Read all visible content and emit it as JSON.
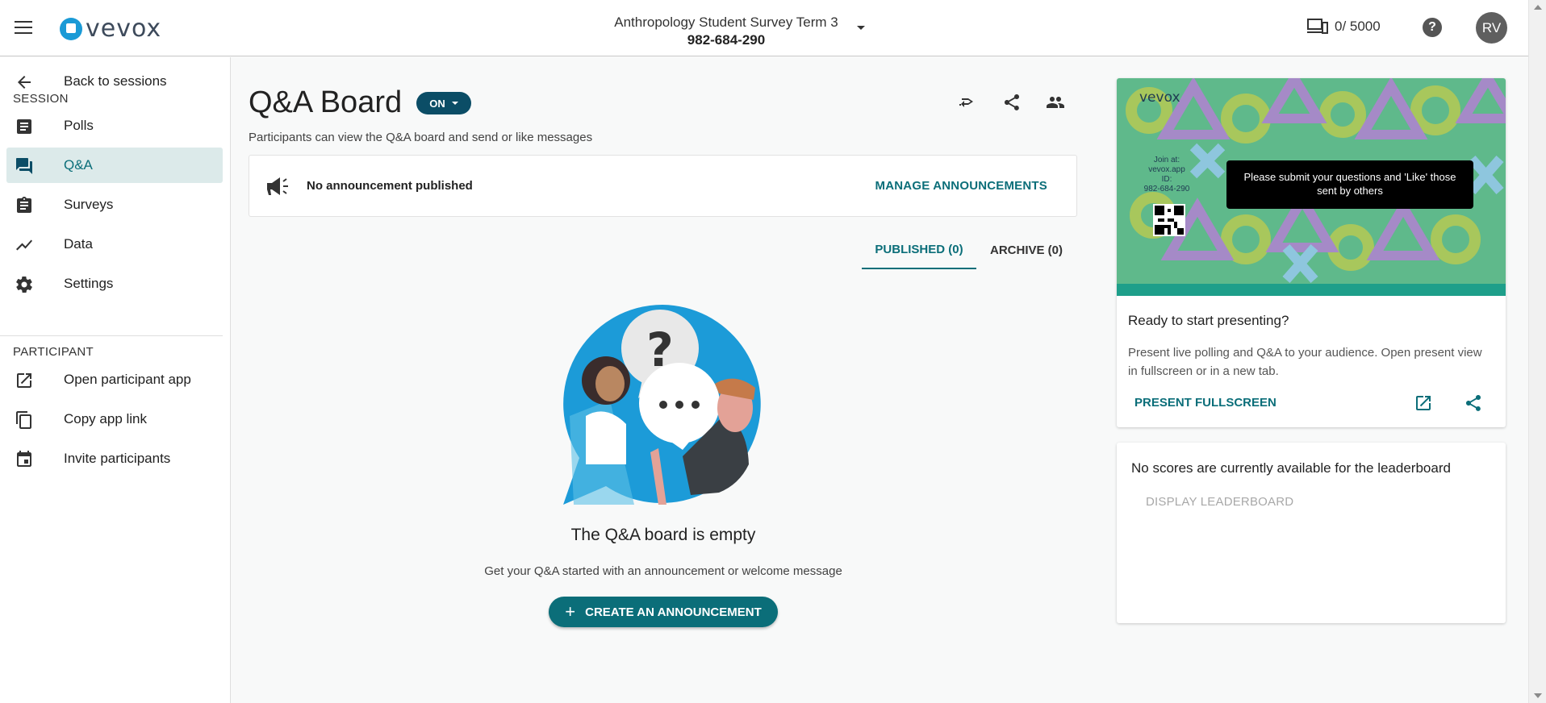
{
  "app": {
    "logo_text": "vevox"
  },
  "header": {
    "session_name": "Anthropology Student Survey Term 3",
    "session_code": "982-684-290",
    "participants_count": "0/ 5000",
    "help_label": "?",
    "avatar_initials": "RV"
  },
  "sidebar": {
    "back_label": "Back to sessions",
    "session_heading": "SESSION",
    "session_items": [
      {
        "label": "Polls",
        "icon": "polls-icon"
      },
      {
        "label": "Q&A",
        "icon": "qa-icon",
        "active": true
      },
      {
        "label": "Surveys",
        "icon": "surveys-icon"
      },
      {
        "label": "Data",
        "icon": "data-icon"
      },
      {
        "label": "Settings",
        "icon": "gear-icon"
      }
    ],
    "participant_heading": "PARTICIPANT",
    "participant_items": [
      {
        "label": "Open participant app",
        "icon": "open-external-icon"
      },
      {
        "label": "Copy app link",
        "icon": "copy-icon"
      },
      {
        "label": "Invite participants",
        "icon": "calendar-icon"
      }
    ]
  },
  "main": {
    "title": "Q&A Board",
    "toggle_label": "ON",
    "subtitle": "Participants can view the Q&A board and send or like messages",
    "announcement": {
      "text": "No announcement published",
      "manage_label": "MANAGE ANNOUNCEMENTS"
    },
    "tabs": [
      {
        "label": "PUBLISHED (0)",
        "active": true
      },
      {
        "label": "ARCHIVE (0)",
        "active": false
      }
    ],
    "empty_title": "The Q&A board is empty",
    "empty_subtitle": "Get your Q&A started with an announcement or welcome message",
    "create_label": "CREATE AN ANNOUNCEMENT"
  },
  "present": {
    "preview_logo": "vevox",
    "preview_join_label": "Join at:",
    "preview_join_url": "vevox.app",
    "preview_id_label": "ID:",
    "preview_id": "982-684-290",
    "preview_message": "Please submit your questions and 'Like' those sent by others",
    "title": "Ready to start presenting?",
    "description": "Present live polling and Q&A to your audience. Open present view in fullscreen or in a new tab.",
    "fullscreen_label": "PRESENT FULLSCREEN"
  },
  "leaderboard": {
    "message": "No scores are currently available for the leaderboard",
    "display_label": "DISPLAY LEADERBOARD"
  },
  "colors": {
    "accent": "#0b6e79",
    "toggle_bg": "#0b4d66",
    "active_nav_bg": "#dceaea",
    "preview_bg": "#5fb98b"
  }
}
